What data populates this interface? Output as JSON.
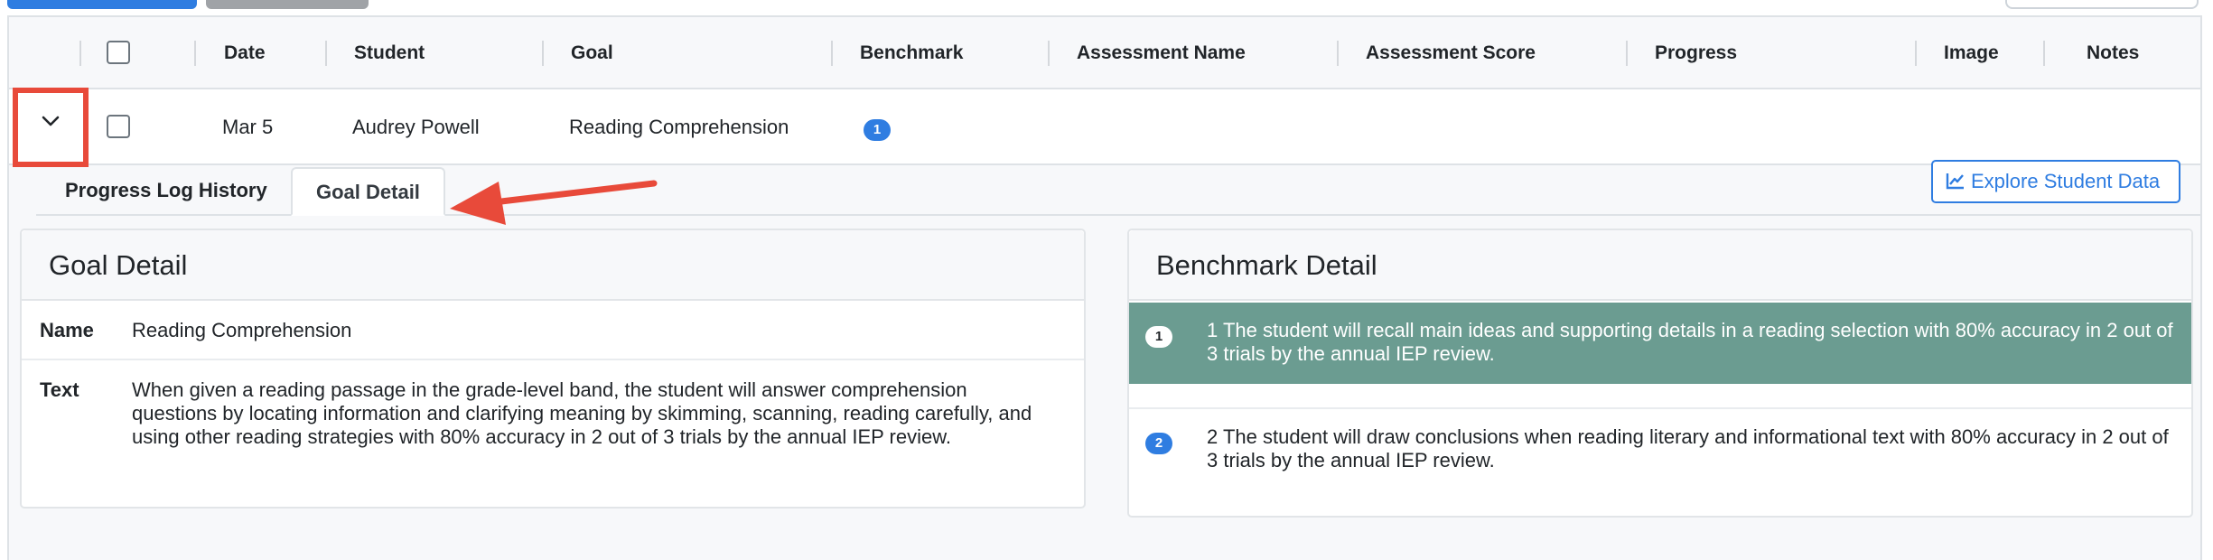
{
  "table": {
    "columns": [
      "Date",
      "Student",
      "Goal",
      "Benchmark",
      "Assessment Name",
      "Assessment Score",
      "Progress",
      "Image",
      "Notes"
    ],
    "row": {
      "date": "Mar 5",
      "student": "Audrey Powell",
      "goal": "Reading Comprehension",
      "benchmark_count": "1"
    }
  },
  "tabs": [
    {
      "label": "Progress Log History",
      "active": false
    },
    {
      "label": "Goal Detail",
      "active": true
    }
  ],
  "explore_button": {
    "label": "Explore Student Data",
    "icon": "line-chart-icon"
  },
  "goal_detail": {
    "title": "Goal Detail",
    "name_label": "Name",
    "name_value": "Reading Comprehension",
    "text_label": "Text",
    "text_value": "When given a reading passage in the grade-level band, the student will answer comprehension questions by locating information and clarifying meaning by skimming, scanning, reading carefully, and using other reading strategies with 80% accuracy in 2 out of 3 trials by the annual IEP review."
  },
  "benchmark_detail": {
    "title": "Benchmark Detail",
    "items": [
      {
        "badge": "1",
        "text": "1 The student will recall main ideas and supporting details in a reading selection with 80% accuracy in 2 out of 3 trials by the annual IEP review.",
        "selected": true
      },
      {
        "badge": "2",
        "text": "2 The student will draw conclusions when reading literary and informational text with 80% accuracy in 2 out of 3 trials by the annual IEP review.",
        "selected": false
      }
    ]
  },
  "colors": {
    "primary": "#2f7de1",
    "highlight": "#e84a3a",
    "selected_benchmark": "#6b9c91"
  }
}
